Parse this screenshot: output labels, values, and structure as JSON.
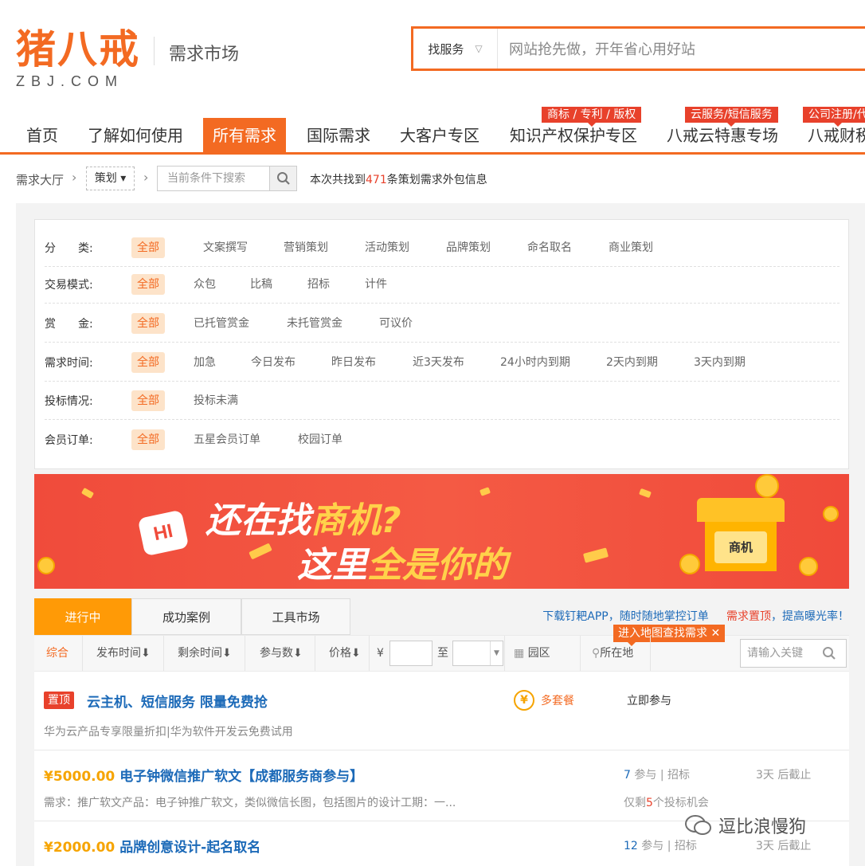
{
  "header": {
    "logo_text": "猪八戒",
    "logo_sub": "ZBJ.COM",
    "section": "需求市场",
    "search_type": "找服务",
    "search_placeholder": "网站抢先做，开年省心用好站"
  },
  "nav": {
    "items": [
      "首页",
      "了解如何使用",
      "所有需求",
      "国际需求",
      "大客户专区",
      "知识产权保护专区",
      "八戒云特惠专场",
      "八戒财税"
    ],
    "active": "所有需求",
    "badges": [
      "商标 / 专利 / 版权",
      "云服务/短信服务",
      "公司注册/代"
    ]
  },
  "breadcrumb": {
    "hall": "需求大厅",
    "category": "策划",
    "search_placeholder": "当前条件下搜索",
    "count_prefix": "本次共找到",
    "count": "471",
    "count_suffix": "条策划需求外包信息"
  },
  "filters": [
    {
      "label": "分　　类:",
      "options": [
        "全部",
        "文案撰写",
        "营销策划",
        "活动策划",
        "品牌策划",
        "命名取名",
        "商业策划"
      ]
    },
    {
      "label": "交易模式:",
      "options": [
        "全部",
        "众包",
        "比稿",
        "招标",
        "计件"
      ]
    },
    {
      "label": "赏　　金:",
      "options": [
        "全部",
        "已托管赏金",
        "未托管赏金",
        "可议价"
      ]
    },
    {
      "label": "需求时间:",
      "options": [
        "全部",
        "加急",
        "今日发布",
        "昨日发布",
        "近3天发布",
        "24小时内到期",
        "2天内到期",
        "3天内到期"
      ]
    },
    {
      "label": "投标情况:",
      "options": [
        "全部",
        "投标未满"
      ]
    },
    {
      "label": "会员订单:",
      "options": [
        "全部",
        "五星会员订单",
        "校园订单"
      ]
    }
  ],
  "banner": {
    "hi": "HI",
    "line1_a": "还在找",
    "line1_b": "商机?",
    "line2_a": "这里",
    "line2_b": "全是你的",
    "shop_sign": "商机"
  },
  "tabs": {
    "items": [
      "进行中",
      "成功案例",
      "工具市场"
    ],
    "active": "进行中",
    "link_app": "下载钉耙APP，随时随地掌控订单",
    "link_top_red": "需求置顶",
    "link_top_blue": "，提高曝光率！"
  },
  "sortbar": {
    "items": [
      "综合",
      "发布时间⬇",
      "剩余时间⬇",
      "参与数⬇",
      "价格⬇"
    ],
    "currency": "¥",
    "to": "至",
    "park": "园区",
    "location": "所在地",
    "map_tip": "进入地图查找需求",
    "keyword_placeholder": "请输入关键"
  },
  "list": [
    {
      "badge": "置顶",
      "title": "云主机、短信服务 限量免费抢",
      "desc": "华为云产品专享限量折扣|华为软件开发云免费试用",
      "package": "多套餐",
      "action": "立即参与"
    },
    {
      "price": "¥5000.00",
      "title": "电子钟微信推广软文【成都服务商参与】",
      "desc": "需求：推广软文产品：电子钟推广软文，类似微信长图，包括图片的设计工期：一...",
      "participants": "7",
      "participants_label": "参与 | 招标",
      "remaining_prefix": "仅剩",
      "remaining": "5",
      "remaining_suffix": "个投标机会",
      "deadline": "3天 后截止"
    },
    {
      "price": "¥2000.00",
      "title": "品牌创意设计-起名取名",
      "participants": "12",
      "participants_label": "参与 | 招标",
      "deadline": "3天 后截止"
    }
  ],
  "watermark": "逗比浪慢狗",
  "colors": {
    "brand": "#f36a22",
    "red": "#e8412b",
    "link": "#1c6ab8",
    "price": "#f6a400",
    "tab_active": "#ff9a06"
  }
}
